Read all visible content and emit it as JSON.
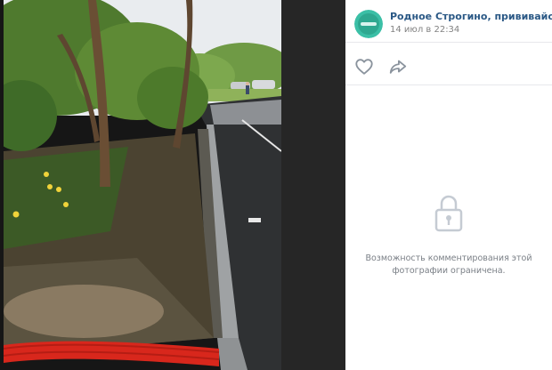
{
  "post": {
    "author": "Родное Строгино, прививайся!",
    "date": "14 июл в 22:34"
  },
  "actions": {
    "like_icon": "heart-icon",
    "share_icon": "share-arrow-icon"
  },
  "comments": {
    "lock_icon": "lock-icon",
    "restricted_text": "Возможность комментирования этой фотографии ограничена."
  },
  "colors": {
    "author_link": "#2a5885",
    "muted_text": "#828282",
    "viewer_background": "#1a1a1a"
  }
}
